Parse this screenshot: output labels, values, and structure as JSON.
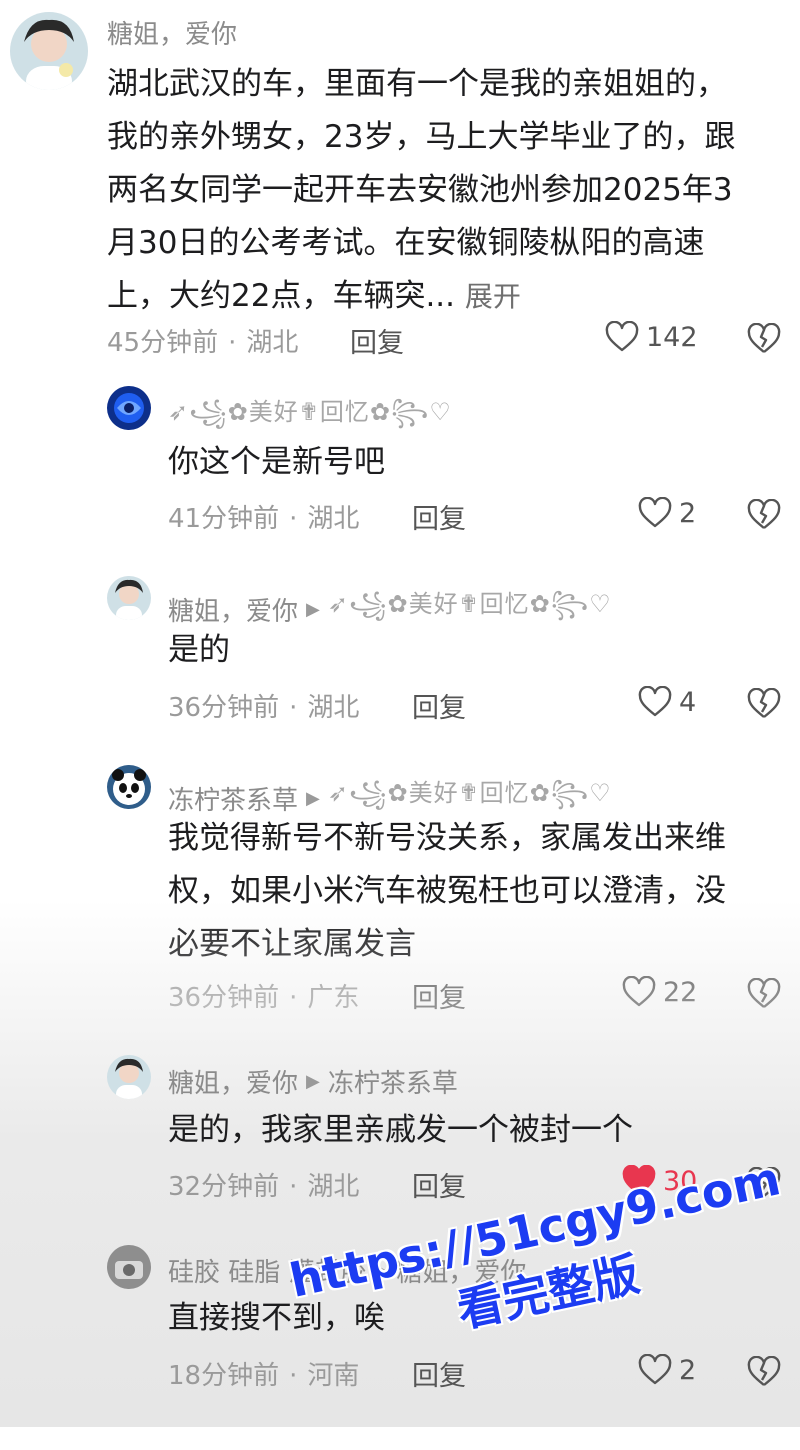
{
  "comments": [
    {
      "user": "糖姐，爱你",
      "text_lines": [
        "湖北武汉的车，里面有一个是我的亲姐姐的，",
        "我的亲外甥女，23岁，马上大学毕业了的，跟",
        "两名女同学一起开车去安徽池州参加2025年3",
        "月30日的公考考试。在安徽铜陵枞阳的高速",
        "上，大约22点，车辆突..."
      ],
      "expand": "展开",
      "time": "45分钟前",
      "location": "湖北",
      "reply": "回复",
      "likes": "142"
    },
    {
      "user": "➶꧁✿美好✟回忆✿꧂♡",
      "text": "你这个是新号吧",
      "time": "41分钟前",
      "location": "湖北",
      "reply": "回复",
      "likes": "2"
    },
    {
      "user": "糖姐，爱你",
      "reply_to": "➶꧁✿美好✟回忆✿꧂♡",
      "text": "是的",
      "time": "36分钟前",
      "location": "湖北",
      "reply": "回复",
      "likes": "4"
    },
    {
      "user": "冻柠茶系草",
      "reply_to": "➶꧁✿美好✟回忆✿꧂♡",
      "text_lines": [
        "我觉得新号不新号没关系，家属发出来维",
        "权，如果小米汽车被冤枉也可以澄清，没",
        "必要不让家属发言"
      ],
      "time": "36分钟前",
      "location": "广东",
      "reply": "回复",
      "likes": "22"
    },
    {
      "user": "糖姐，爱你",
      "reply_to": "冻柠茶系草",
      "text": "是的，我家里亲戚发一个被封一个",
      "time": "32分钟前",
      "location": "湖北",
      "reply": "回复",
      "likes": "30",
      "liked": true
    },
    {
      "user": "硅胶 硅脂 灌封胶",
      "reply_to": "糖姐，爱你",
      "text": "直接搜不到，唉",
      "time": "18分钟前",
      "location": "河南",
      "reply": "回复",
      "likes": "2"
    }
  ],
  "watermark": {
    "url": "https://51cgy9.com",
    "label": "看完整版",
    "color": "#1c3cf2"
  },
  "icons": {
    "like": "heart-outline-icon",
    "liked": "heart-filled-icon",
    "dislike": "broken-heart-icon",
    "reply_arrow": "triangle-right-icon"
  },
  "colors": {
    "liked": "#e8364f",
    "meta": "#9a9a9a",
    "username": "#8b8b8b"
  }
}
